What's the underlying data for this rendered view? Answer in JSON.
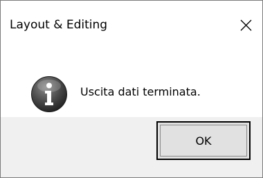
{
  "window": {
    "title": "Layout & Editing",
    "close_icon": "close-icon"
  },
  "message": {
    "icon": "info-icon",
    "text": "Uscita dati terminata."
  },
  "buttons": {
    "ok_label": "OK"
  },
  "colors": {
    "footer_bg": "#f0f0f0",
    "button_bg": "#e1e1e1",
    "icon_gradient_light": "#7a7a7a",
    "icon_gradient_dark": "#2a2a2a"
  }
}
